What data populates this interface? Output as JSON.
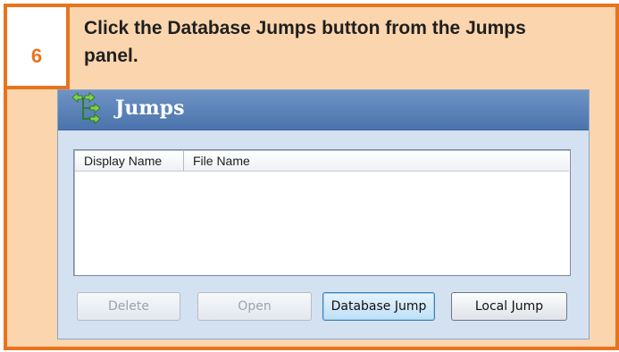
{
  "step": {
    "number": "6",
    "instruction": "Click the Database Jumps button from the Jumps panel."
  },
  "panel": {
    "title": "Jumps",
    "icon": "jumps-arrows-icon",
    "columns": [
      "Display Name",
      "File Name"
    ],
    "rows": [],
    "buttons": {
      "delete": "Delete",
      "open": "Open",
      "database_jump": "Database Jump",
      "local_jump": "Local Jump"
    }
  },
  "colors": {
    "accent": "#e8741e",
    "background": "#fbd5ad",
    "header": "#4a74ad"
  }
}
